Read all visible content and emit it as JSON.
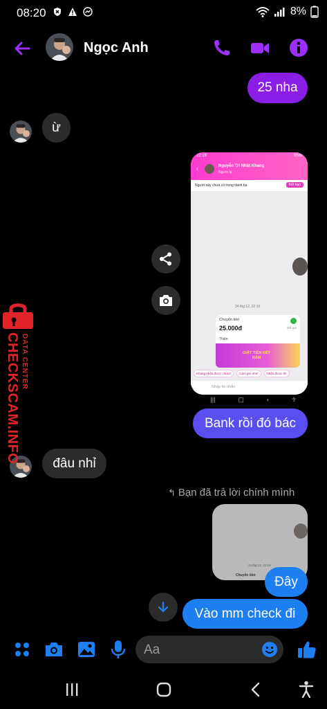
{
  "status_bar": {
    "time": "08:20",
    "battery": "8%",
    "icons": [
      "shield-x-icon",
      "warning-icon",
      "messenger-icon",
      "wifi-icon",
      "signal-icon"
    ]
  },
  "header": {
    "contact_name": "Ngọc Anh",
    "icons": [
      "back-arrow-icon",
      "phone-icon",
      "video-icon",
      "info-icon"
    ],
    "accent": "#9b30ff"
  },
  "messages": {
    "m1": "25 nha",
    "m2": "ừ",
    "m3": "Bank rồi đó bác",
    "m4": "đâu nhỉ",
    "reply_note": "Bạn đã trả lời chính mình",
    "m5": "Đây",
    "m6": "Vào mm check đi"
  },
  "shared_screenshot": {
    "time": "22:19",
    "battery": "65%",
    "contact": "Nguyễn Trí Nhật Khang",
    "contact_sub": "Người lạ",
    "banner": "Người này chưa có trong danh bạ",
    "banner_btn": "Kết bạn",
    "date": "24 thg 12, 22:19",
    "card_title": "Chuyển tiền",
    "card_amount": "25.000đ",
    "card_status": "Đã gửi",
    "card_note": "Thiện",
    "card_banner": "GIẬT TIỀN KẾT NĂM",
    "chips": [
      "Khang nhận được chưa?",
      "Cảm gửi nhé!",
      "Nhận được thì"
    ],
    "input_placeholder": "Nhập tin nhắn"
  },
  "reply_preview": {
    "date": "24 thg 12, 22:19",
    "card_title": "Chuyển tiền"
  },
  "watermark": {
    "brand": "CHECKSCAM.INFO",
    "tag": "DATA CENTER"
  },
  "composer": {
    "placeholder": "Aa",
    "icons": [
      "apps-grid-icon",
      "camera-icon",
      "image-icon",
      "mic-icon",
      "emoji-icon",
      "thumbs-up-icon"
    ],
    "accent": "#1e7ff2"
  },
  "nav": {
    "icons": [
      "recents-icon",
      "home-icon",
      "back-icon",
      "accessibility-icon"
    ]
  }
}
